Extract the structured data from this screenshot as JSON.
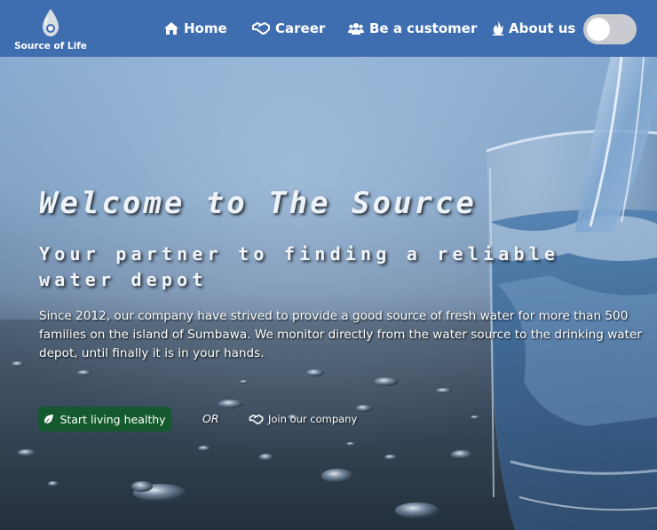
{
  "brand": {
    "name": "Source of Life",
    "logo_icon": "water-drop-icon"
  },
  "nav": {
    "items": [
      {
        "label": "Home",
        "icon": "home-icon"
      },
      {
        "label": "Career",
        "icon": "handshake-icon"
      },
      {
        "label": "Be a customer",
        "icon": "users-icon"
      },
      {
        "label": "About us",
        "icon": "fire-icon"
      }
    ],
    "theme_toggle": {
      "state": "off"
    }
  },
  "hero": {
    "title": "Welcome to The Source",
    "subtitle": "Your partner to finding a reliable water depot",
    "description": "Since 2012, our company have strived to provide a good source of fresh water for more than 500 families on the island of Sumbawa. We monitor directly from the water source to the drinking water depot, until finally it is in your hands.",
    "primary_cta": {
      "label": "Start living healthy",
      "icon": "leaf-icon"
    },
    "or_label": "OR",
    "secondary_cta": {
      "label": "Join our company",
      "icon": "handshake-icon"
    }
  },
  "colors": {
    "navbar": "#3f6eb0",
    "primary_button": "#145a2e",
    "toggle_track": "#c9cbd0",
    "text": "#ffffff"
  }
}
